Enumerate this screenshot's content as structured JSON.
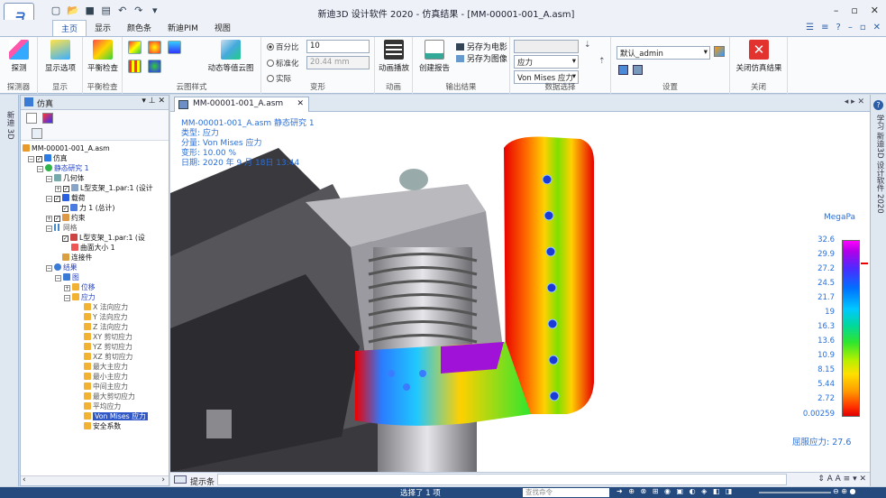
{
  "title_bar": {
    "app_title": "新迪3D 设计软件 2020 - 仿真结果 - [MM-00001-001_A.asm]",
    "window_controls": [
      "–",
      "▫",
      "✕"
    ]
  },
  "ribbon": {
    "tabs": [
      "主页",
      "显示",
      "颜色条",
      "新迪PIM",
      "视图"
    ],
    "active_tab": "主页",
    "groups": {
      "probe": {
        "label": "探测器",
        "button": "探测"
      },
      "display": {
        "label": "显示",
        "button": "显示选项"
      },
      "balance": {
        "label": "平衡检查",
        "button": "平衡检查"
      },
      "cloud": {
        "label": "云图样式",
        "dynamic_button": "动态等值云图"
      },
      "deform": {
        "label": "变形",
        "percent_label": "百分比",
        "percent_value": "10",
        "normalize_label": "标准化",
        "normalize_placeholder": "20.44 mm",
        "actual_label": "实际"
      },
      "animation": {
        "label": "动画",
        "button": "动画播放"
      },
      "output": {
        "label": "输出结果",
        "report_button": "创建报告",
        "save_movie": "另存为电影",
        "save_image": "另存为图像"
      },
      "data_select": {
        "label": "数据选择",
        "type_value": "应力",
        "component_value": "Von Mises 应力"
      },
      "settings": {
        "label": "设置",
        "user_value": "默认_admin"
      },
      "close": {
        "label": "关闭",
        "button": "关闭仿真结果"
      }
    }
  },
  "left_strip": {
    "label": "新迪 3D"
  },
  "right_strip": {
    "label": "学习 新迪3D 设计软件 2020"
  },
  "tree_panel": {
    "title": "仿真",
    "rows": [
      {
        "text": "MM-00001-001_A.asm",
        "color": "black"
      },
      {
        "text": "仿真",
        "color": "black"
      },
      {
        "text": "静态研究 1",
        "color": "blue"
      },
      {
        "text": "几何体",
        "color": "black"
      },
      {
        "text": "L型支架_1.par:1 (设计",
        "color": "black"
      },
      {
        "text": "载荷",
        "color": "black"
      },
      {
        "text": "力 1 (总计)",
        "color": "black"
      },
      {
        "text": "约束",
        "color": "black"
      },
      {
        "text": "网格",
        "color": "gray"
      },
      {
        "text": "L型支架_1.par:1 (设",
        "color": "black"
      },
      {
        "text": "曲面大小 1",
        "color": "black"
      },
      {
        "text": "连接件",
        "color": "black"
      },
      {
        "text": "结果",
        "color": "blue"
      },
      {
        "text": "图",
        "color": "blue"
      },
      {
        "text": "位移",
        "color": "blue"
      },
      {
        "text": "应力",
        "color": "blue"
      },
      {
        "text": "X 法向应力",
        "color": "gray"
      },
      {
        "text": "Y 法向应力",
        "color": "gray"
      },
      {
        "text": "Z 法向应力",
        "color": "gray"
      },
      {
        "text": "XY 剪切应力",
        "color": "gray"
      },
      {
        "text": "YZ 剪切应力",
        "color": "gray"
      },
      {
        "text": "XZ 剪切应力",
        "color": "gray"
      },
      {
        "text": "最大主应力",
        "color": "gray"
      },
      {
        "text": "最小主应力",
        "color": "gray"
      },
      {
        "text": "中间主应力",
        "color": "gray"
      },
      {
        "text": "最大剪切应力",
        "color": "gray"
      },
      {
        "text": "平均应力",
        "color": "gray"
      },
      {
        "text": "Von Mises 应力",
        "color": "selected"
      },
      {
        "text": "安全系数",
        "color": "black"
      }
    ]
  },
  "viewport": {
    "doc_tab": "MM-00001-001_A.asm",
    "overlay": [
      "MM-00001-001_A.asm 静态研究 1",
      "类型: 应力",
      "分量: Von Mises 应力",
      "变形: 10.00 %",
      "日期: 2020 年 9 月 18日 13:44"
    ],
    "legend": {
      "unit": "MegaPa",
      "labels": [
        "32.6",
        "29.9",
        "27.2",
        "24.5",
        "21.7",
        "19",
        "16.3",
        "13.6",
        "10.9",
        "8.15",
        "5.44",
        "2.72",
        "0.00259"
      ]
    },
    "yield_text": "屈服应力: 27.6"
  },
  "prompt_bar": {
    "label": "提示条"
  },
  "status_bar": {
    "message": "选择了 1 项",
    "command_placeholder": "查找命令"
  },
  "colors": {
    "accent": "#1d4e9e",
    "status_bg": "#244a7e",
    "overlay_text": "#2a6fd8"
  }
}
